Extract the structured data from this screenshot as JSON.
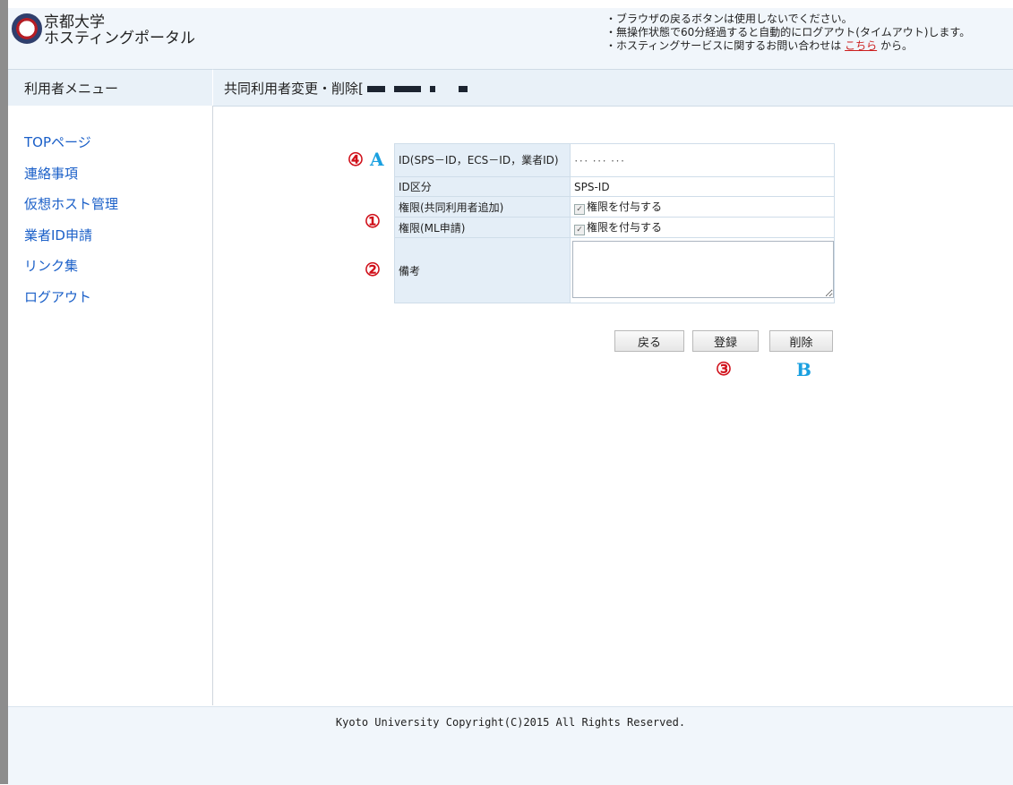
{
  "header": {
    "logo_name": "京都大学 logo",
    "title_line1": "京都大学",
    "title_line2": "ホスティングポータル",
    "notice1": "・ブラウザの戻るボタンは使用しないでください。",
    "notice2": "・無操作状態で60分経過すると自動的にログアウト(タイムアウト)します。",
    "notice3_pre": "・ホスティングサービスに関するお問い合わせは ",
    "notice3_link": "こちら",
    "notice3_post": " から。"
  },
  "sidebar": {
    "heading": "利用者メニュー",
    "items": [
      {
        "label": "TOPページ"
      },
      {
        "label": "連絡事項"
      },
      {
        "label": "仮想ホスト管理"
      },
      {
        "label": "業者ID申請"
      },
      {
        "label": "リンク集"
      },
      {
        "label": "ログアウト"
      }
    ]
  },
  "main": {
    "title": "共同利用者変更・削除[",
    "form": {
      "id_label": "ID(SPS－ID，ECS－ID，業者ID)",
      "id_value": "･･･ ･･･ ･･･",
      "id_type_label": "ID区分",
      "id_type_value": "SPS-ID",
      "perm_add_label": "権限(共同利用者追加)",
      "perm_add_check": "権限を付与する",
      "perm_ml_label": "権限(ML申請)",
      "perm_ml_check": "権限を付与する",
      "note_label": "備考",
      "note_value": ""
    },
    "buttons": {
      "back": "戻る",
      "register": "登録",
      "delete": "削除"
    },
    "annotations": {
      "m4": "④",
      "mA": "A",
      "m1": "①",
      "m2": "②",
      "m3": "③",
      "mB": "B"
    }
  },
  "footer": {
    "copyright": "Kyoto University Copyright(C)2015 All Rights Reserved."
  }
}
